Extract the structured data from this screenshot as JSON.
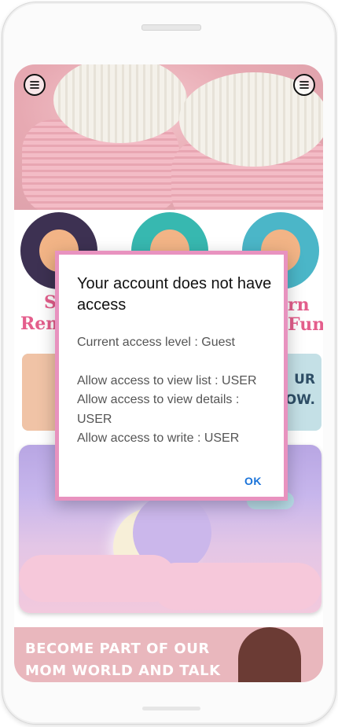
{
  "dialog": {
    "title": "Your account does not have access",
    "current_level": "Current access level : Guest",
    "view_list": "Allow access to view list : USER",
    "view_details": "Allow access to view details : USER",
    "write": "Allow access to write : USER",
    "ok_label": "OK"
  },
  "cards": {
    "left_label_top": "S",
    "left_label_bottom": "Rem",
    "right_label_top": "rn",
    "right_label_bottom": "Fun",
    "strip_line1": "UR",
    "strip_line2": "OW."
  },
  "banner": {
    "line1": "BECOME PART OF OUR",
    "line2": "MOM WORLD AND TALK"
  },
  "icons": {
    "left_menu": "menu-icon",
    "right_menu": "menu-icon"
  }
}
